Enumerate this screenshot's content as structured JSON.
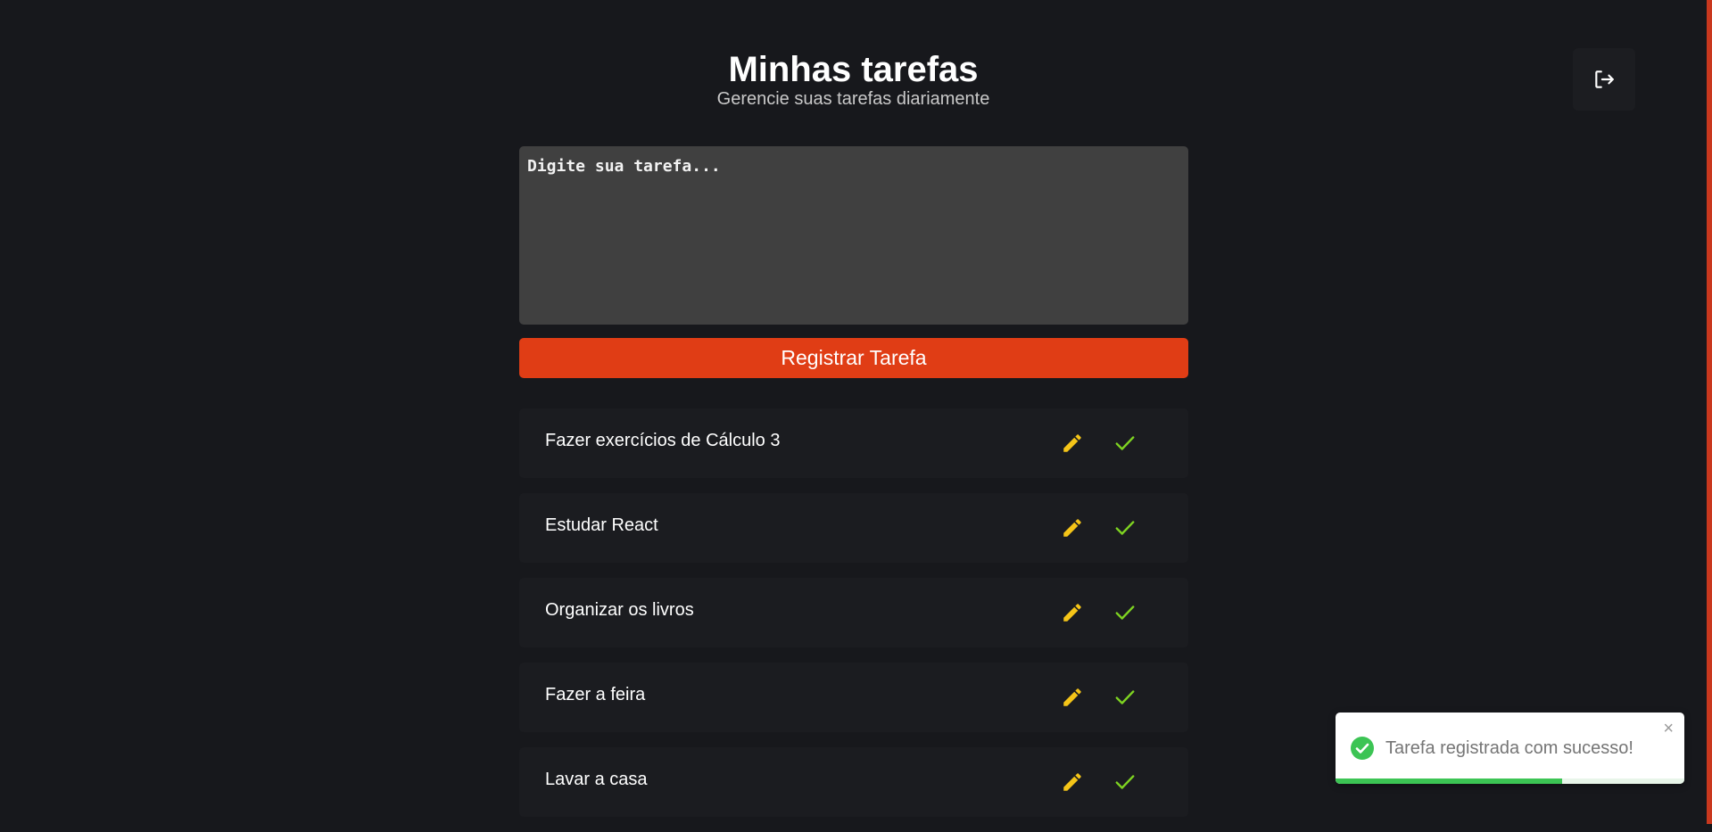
{
  "header": {
    "title": "Minhas tarefas",
    "subtitle": "Gerencie suas tarefas diariamente",
    "logout_icon": "logout-icon"
  },
  "form": {
    "placeholder": "Digite sua tarefa...",
    "value": "",
    "submit_label": "Registrar Tarefa"
  },
  "tasks": [
    {
      "text": "Fazer exercícios de Cálculo 3"
    },
    {
      "text": "Estudar React"
    },
    {
      "text": "Organizar os livros"
    },
    {
      "text": "Fazer a feira"
    },
    {
      "text": "Lavar a casa"
    }
  ],
  "icons": {
    "edit": "pencil-icon",
    "complete": "check-icon",
    "toast": "check-circle-icon",
    "close": "close-icon"
  },
  "toast": {
    "message": "Tarefa registrada com sucesso!",
    "close_glyph": "×",
    "progress_fraction": 0.65
  },
  "colors": {
    "background": "#17181c",
    "accent": "#e03d15",
    "edit_icon": "#f5c518",
    "check_icon": "#7ed321",
    "success": "#3cc454"
  }
}
